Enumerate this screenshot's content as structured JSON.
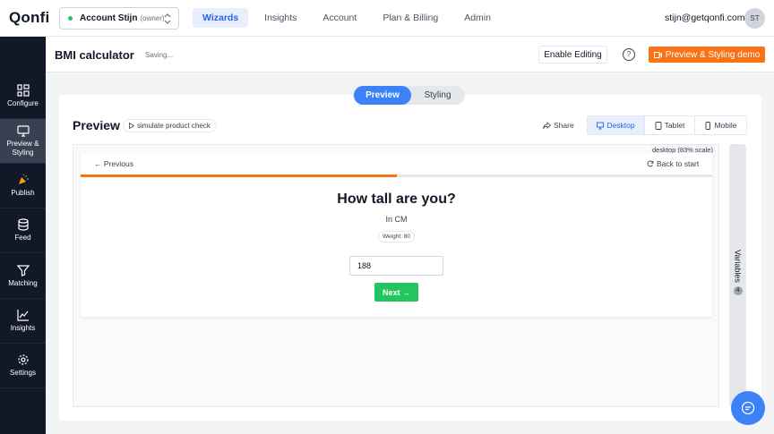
{
  "app": {
    "logo": "Qonfi"
  },
  "account": {
    "name": "Account Stijn",
    "role": "(owner)"
  },
  "nav": {
    "items": [
      "Wizards",
      "Insights",
      "Account",
      "Plan & Billing",
      "Admin"
    ],
    "active": "Wizards"
  },
  "user": {
    "email": "stijn@getqonfi.com",
    "initials": "ST"
  },
  "sidebar": {
    "items": [
      {
        "label": "Configure",
        "icon": "configure-icon"
      },
      {
        "label": "Preview & Styling",
        "icon": "monitor-icon",
        "active": true
      },
      {
        "label": "Publish",
        "icon": "party-popper-icon"
      },
      {
        "label": "Feed",
        "icon": "database-icon"
      },
      {
        "label": "Matching",
        "icon": "funnel-icon"
      },
      {
        "label": "Insights",
        "icon": "line-chart-icon"
      },
      {
        "label": "Settings",
        "icon": "gear-icon"
      }
    ]
  },
  "header": {
    "title": "BMI calculator",
    "status": "Saving...",
    "enable_editing": "Enable Editing",
    "help": "?",
    "demo_button": "Preview & Styling demo"
  },
  "mode_toggle": {
    "options": [
      "Preview",
      "Styling"
    ],
    "active": "Preview"
  },
  "preview": {
    "title": "Preview",
    "simulate": "simulate product check",
    "share": "Share",
    "devices": [
      "Desktop",
      "Tablet",
      "Mobile"
    ],
    "active_device": "Desktop",
    "scale_note": "desktop (83% scale)"
  },
  "wizard": {
    "previous": "Previous",
    "back_to_start": "Back to start",
    "progress_fraction": 0.5,
    "question": "How tall are you?",
    "unit": "In CM",
    "chip": "Weight: 80",
    "input_value": "188",
    "next": "Next"
  },
  "variables": {
    "label": "Variables",
    "count": "4"
  },
  "colors": {
    "accent_blue": "#3b82f6",
    "orange": "#f97316",
    "green": "#22c55e",
    "sidebar_bg": "#111827"
  }
}
